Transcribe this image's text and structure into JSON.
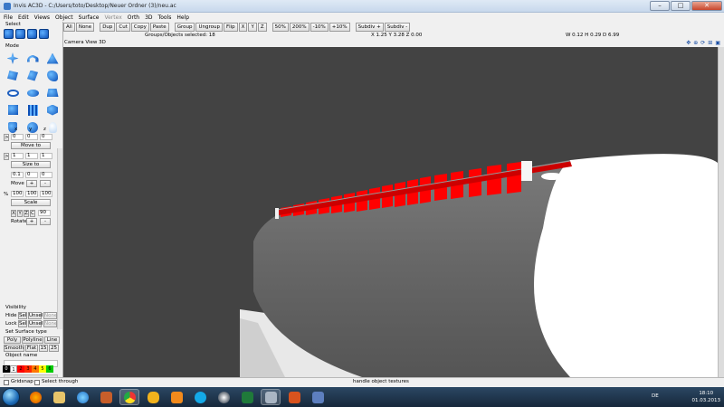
{
  "window": {
    "title": "Invis AC3D - C:/Users/toto/Desktop/Neuer Ordner (3)/neu.ac"
  },
  "menu": [
    "File",
    "Edit",
    "Views",
    "Object",
    "Surface",
    "Vertex",
    "Orth",
    "3D",
    "Tools",
    "Help"
  ],
  "toolbar": {
    "buttons": [
      "All",
      "None",
      "Dup",
      "Cut",
      "Copy",
      "Paste",
      "Group",
      "Ungroup",
      "Flip",
      "X",
      "Y",
      "Z",
      "50%",
      "200%",
      "-10%",
      "+10%",
      "Subdiv +",
      "Subdiv -"
    ],
    "groups_selected": "Groups/Objects selected: 18",
    "position_readout": "X 1.25 Y 3.28 Z 0.00",
    "size_readout": "W 0.12 H 0.29 D 6.99"
  },
  "left_panel": {
    "select_label": "Select",
    "mode_label": "Mode",
    "axis_labels": [
      "x",
      "y",
      "z"
    ],
    "move_values": [
      "0",
      "0",
      "0"
    ],
    "move_to_label": "Move to",
    "size_values": [
      "1",
      "1",
      "1"
    ],
    "size_to_label": "Size to",
    "move_step_values": [
      "0.1",
      "0",
      "0"
    ],
    "move_label": "Move",
    "scale_prefix": "%",
    "scale_values": [
      "100",
      "100",
      "100"
    ],
    "scale_label": "Scale",
    "rotate_axes": [
      "X",
      "Y",
      "Z",
      "C"
    ],
    "rotate_value": "90",
    "rotate_label": "Rotate",
    "plus": "+",
    "minus": "-",
    "visibility_label": "Visibility",
    "hide_label": "Hide",
    "lock_label": "Lock",
    "sel_label": "Sel",
    "unsel_label": "Unsel",
    "none_label": "None",
    "surface_type_label": "Set Surface type",
    "surface_buttons": [
      "Poly",
      "Polyline",
      "Line"
    ],
    "shade_buttons": [
      "Smooth",
      "Flat",
      "15",
      "25"
    ],
    "object_name_label": "Object name",
    "palette": [
      {
        "label": "0",
        "color": "#000000"
      },
      {
        "label": "1",
        "color": "#ffffff"
      },
      {
        "label": "2",
        "color": "#ff0000"
      },
      {
        "label": "3",
        "color": "#ff2a00"
      },
      {
        "label": "4",
        "color": "#ff7700"
      },
      {
        "label": "5",
        "color": "#ffff00"
      },
      {
        "label": "6",
        "color": "#00cc00"
      }
    ]
  },
  "viewport": {
    "header": "Camera View 3D",
    "background_color": "#434343",
    "mesh_color": "#686868",
    "accent_color": "#ff0000"
  },
  "statusbar": {
    "gridsnap_label": "Gridsnap",
    "select_through_label": "Select through",
    "hint": "handle object textures"
  },
  "taskbar": {
    "apps": [
      "firefox",
      "explorer",
      "ie",
      "media",
      "chrome",
      "pinwheel",
      "media-player",
      "skype",
      "steam",
      "excel",
      "ac3d",
      "office",
      "window"
    ],
    "language": "DE",
    "time": "18:10",
    "date": "01.03.2013"
  }
}
